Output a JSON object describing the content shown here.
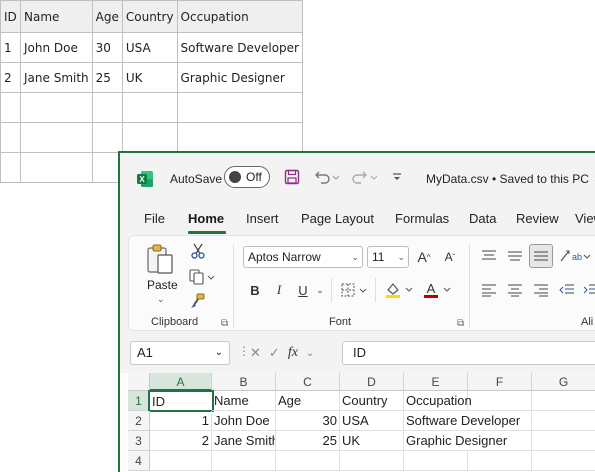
{
  "background_table": {
    "headers": [
      "ID",
      "Name",
      "Age",
      "Country",
      "Occupation"
    ],
    "rows": [
      [
        "1",
        "John Doe",
        "30",
        "USA",
        "Software Developer"
      ],
      [
        "2",
        "Jane Smith",
        "25",
        "UK",
        "Graphic Designer"
      ],
      [
        "",
        "",
        "",
        "",
        ""
      ],
      [
        "",
        "",
        "",
        "",
        ""
      ],
      [
        "",
        "",
        "",
        "",
        ""
      ]
    ]
  },
  "excel": {
    "autosave_label": "AutoSave",
    "autosave_state": "Off",
    "file_title": "MyData.csv • Saved to this PC ⌄",
    "menu": [
      "File",
      "Home",
      "Insert",
      "Page Layout",
      "Formulas",
      "Data",
      "Review",
      "View"
    ],
    "active_menu": "Home",
    "ribbon": {
      "paste_label": "Paste",
      "clipboard_label": "Clipboard",
      "font_label": "Font",
      "alignment_label": "Ali",
      "font_name": "Aptos Narrow",
      "font_size": "11",
      "bold": "B",
      "italic": "I",
      "underline": "U"
    },
    "name_box": "A1",
    "formula_value": "ID",
    "fx": "fx",
    "columns": [
      "A",
      "B",
      "C",
      "D",
      "E",
      "F",
      "G"
    ],
    "rows": [
      {
        "num": "1",
        "cells": [
          "ID",
          "Name",
          "Age",
          "Country",
          "Occupation",
          "",
          ""
        ]
      },
      {
        "num": "2",
        "cells": [
          "1",
          "John Doe",
          "30",
          "USA",
          "Software Developer",
          "",
          ""
        ]
      },
      {
        "num": "3",
        "cells": [
          "2",
          "Jane Smith",
          "25",
          "UK",
          "Graphic Designer",
          "",
          ""
        ]
      },
      {
        "num": "4",
        "cells": [
          "",
          "",
          "",
          "",
          "",
          "",
          ""
        ]
      }
    ]
  },
  "colors": {
    "excel_green": "#217346",
    "font_color_red": "#c00000",
    "highlight_yellow": "#ffd700"
  }
}
